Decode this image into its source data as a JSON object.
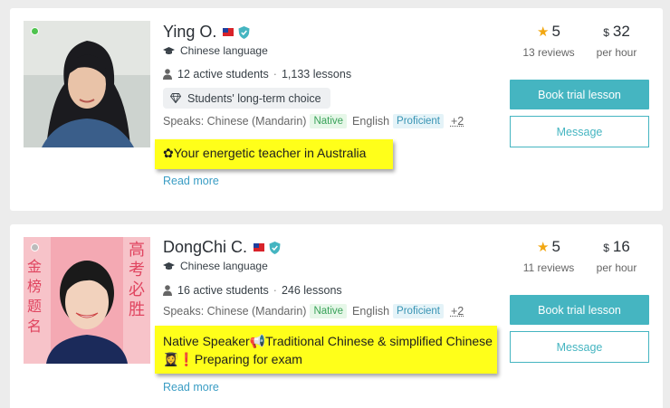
{
  "tutors": [
    {
      "name": "Ying O.",
      "subject": "Chinese language",
      "active_students": "12 active students",
      "lessons": "1,133 lessons",
      "badge": "Students' long-term choice",
      "speaks_label": "Speaks:",
      "lang1": "Chinese (Mandarin)",
      "lang1_level": "Native",
      "lang2": "English",
      "lang2_level": "Proficient",
      "more_langs": "+2",
      "headline": "✿Your energetic teacher in Australia",
      "read_more": "Read more",
      "rating": "5",
      "reviews": "13 reviews",
      "currency": "$",
      "price": "32",
      "per": "per hour",
      "book_label": "Book trial lesson",
      "message_label": "Message"
    },
    {
      "name": "DongChi C.",
      "subject": "Chinese language",
      "active_students": "16 active students",
      "lessons": "246 lessons",
      "speaks_label": "Speaks:",
      "lang1": "Chinese (Mandarin)",
      "lang1_level": "Native",
      "lang2": "English",
      "lang2_level": "Proficient",
      "more_langs": "+2",
      "headline_line1": "Native Speaker📢Traditional Chinese & simplified Chinese",
      "headline_line2": "👩‍🎓❗Preparing for exam",
      "read_more": "Read more",
      "rating": "5",
      "reviews": "11 reviews",
      "currency": "$",
      "price": "16",
      "per": "per hour",
      "book_label": "Book trial lesson",
      "message_label": "Message"
    }
  ],
  "colors": {
    "accent": "#45b5c1",
    "highlight": "#ffff1a",
    "star": "#f2a711",
    "online": "#4fc34f",
    "link": "#3a9dc4"
  }
}
